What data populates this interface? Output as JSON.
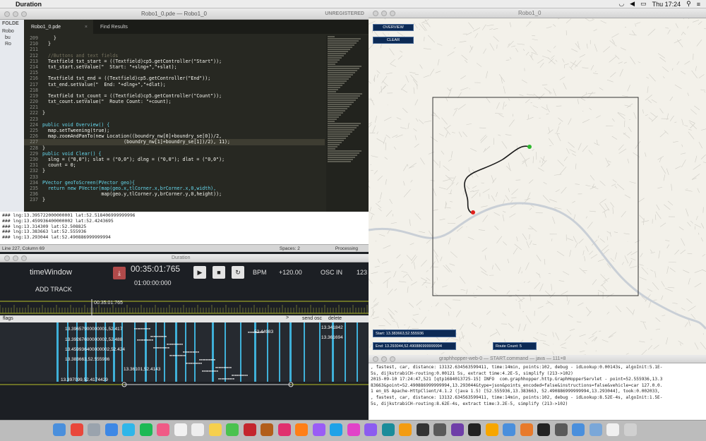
{
  "menubar": {
    "app_name": "Duration",
    "time": "Thu 17:24"
  },
  "sublime": {
    "title": "Robo1_0.pde — Robo1_0",
    "unregistered": "UNREGISTERED",
    "sidebar_header": "FOLDE",
    "sidebar_items": [
      "Robo",
      "bu",
      "Ro"
    ],
    "tabs": [
      "Robo1_0.pde",
      "Find Results"
    ],
    "code_lines": [
      {
        "n": "209",
        "t": "    }"
      },
      {
        "n": "210",
        "t": "  }"
      },
      {
        "n": "211",
        "t": ""
      },
      {
        "n": "212",
        "t": "  //Buttons and text fields"
      },
      {
        "n": "213",
        "t": "  Textfield txt_start = ((Textfield)cp5.getController(\"Start\"));"
      },
      {
        "n": "214",
        "t": "  txt_start.setValue(\"  Start: \"+slng+\",\"+slat);"
      },
      {
        "n": "215",
        "t": ""
      },
      {
        "n": "216",
        "t": "  Textfield txt_end = ((Textfield)cp5.getController(\"End\"));"
      },
      {
        "n": "217",
        "t": "  txt_end.setValue(\"  End: \"+dlng+\",\"+dlat);"
      },
      {
        "n": "218",
        "t": ""
      },
      {
        "n": "219",
        "t": "  Textfield txt_count = ((Textfield)cp5.getController(\"Count\"));"
      },
      {
        "n": "220",
        "t": "  txt_count.setValue(\"  Route Count: \"+count);"
      },
      {
        "n": "221",
        "t": ""
      },
      {
        "n": "222",
        "t": "}"
      },
      {
        "n": "223",
        "t": ""
      },
      {
        "n": "224",
        "t": "public void Overview() {"
      },
      {
        "n": "225",
        "t": "  map.setTweening(true);"
      },
      {
        "n": "226",
        "t": "  map.zoomAndPanTo(new Location((boundry_nw[0]+boundry_se[0])/2,"
      },
      {
        "n": "227",
        "t": "                             (boundry_nw[1]+boundry_se[1])/2), 11);"
      },
      {
        "n": "228",
        "t": "}"
      },
      {
        "n": "229",
        "t": "public void Clear() {"
      },
      {
        "n": "230",
        "t": "  slng = (\"0,0\"); slat = (\"0,0\"); dlng = (\"0,0\"); dlat = (\"0,0\");"
      },
      {
        "n": "231",
        "t": "  count = 0;"
      },
      {
        "n": "232",
        "t": "}"
      },
      {
        "n": "233",
        "t": ""
      },
      {
        "n": "234",
        "t": "PVector geoToScreen(PVector geo){"
      },
      {
        "n": "235",
        "t": "  return new PVector(map(geo.x,tlCorner.x,brCorner.x,0,width),"
      },
      {
        "n": "236",
        "t": "                     map(geo.y,tlCorner.y,brCorner.y,0,height));"
      },
      {
        "n": "237",
        "t": "}"
      }
    ],
    "console_lines": [
      "### lng:13.395722000000001 lat:52.518406999999996",
      "### lng:13.459936400000002 lat:52.4243695",
      "### lng:13.314309 lat:52.508825",
      "### lng:13.383663 lat:52.555936",
      "### lng:13.293044 lat:52.490886999999994"
    ],
    "status_left": "Line 227, Column 69",
    "status_spaces": "Spaces: 2",
    "status_lang": "Processing"
  },
  "map": {
    "title": "Robo1_0",
    "overview_label": "OVERVIEW",
    "clear_label": "CLEAR",
    "start_field": "Start: 13.383663,52.555936",
    "end_field": "End: 13.293044,52.490886999999994",
    "count_field": "Route Count: 5",
    "route_start_color": "#2db82d",
    "route_end_color": "#e0201c"
  },
  "terminal": {
    "title": "graphhopper-web-0 — START.command — java — 111×8",
    "lines": [
      ", fastest, car, distance: 13132.634563599411, time:14min, points:102, debug - idLookup:0.00143s, algoInit:5.1E-",
      "5s, dijkstrabiCH-routing:0.00121 5s, extract time:4.2E-5, simplify (213->102)",
      "2015-09-10 17:24:47,521 [qtp1684013725-15] INFO  com.graphhopper.http.GraphHopperServlet - point=52.555936,13.3",
      "83663&point=52.490886999999994,13.293044&type=json&points_encoded=false&instructions=false&vehicle=car 127.0.0.",
      "1 en_US Apache-HttpClient/4.1.2 (java 1.5) [52.555936,13.383663, 52.490886999999994,13.293044], took:0.002033,",
      ", fastest, car, distance: 13132.634563599411, time:14min, points:102, debug - idLookup:8.52E-4s, algoInit:1.5E-",
      "5s, dijkstrabiCH-routing:8.62E-4s, extract time:3.2E-5, simplify (213->102)"
    ]
  },
  "duration": {
    "title": "Duration",
    "track_name": "timeWindow",
    "add_track": "ADD TRACK",
    "time_main": "00:35:01:765",
    "time_sub": "01:00:00:000",
    "bpm_label": "BPM",
    "bpm_value": "+120.00",
    "osc_label": "OSC IN",
    "osc_value": "123",
    "playhead_time": "00:35:01:765",
    "flags_label": "flags",
    "send_osc": "send osc",
    "delete_label": "delete",
    "track_labels": [
      "13.39657900000001,52.417",
      "13.39267600000002,52.488",
      "13.459936400000002,52.424",
      "13.383663,52.555936",
      "13.36101,52.4143",
      "13.397099,52.4174429",
      "52.44983",
      "13.341842",
      "13.361694"
    ]
  },
  "dock": {
    "items": [
      "Finder",
      "Chrome",
      "Rocket",
      "Safari",
      "Chat",
      "Spotify",
      "iTunes",
      "Calendar",
      "TextEdit",
      "Notes",
      "Messages",
      "Flash",
      "Bridge",
      "InDesign",
      "Illustrator",
      "After Effects",
      "Audition",
      "Photoshop",
      "Premiere",
      "Arduino",
      "Sublime",
      "Terminal",
      "Preview",
      "Resolume",
      "Processing",
      "Sketch",
      "Finder2",
      "Books",
      "GitHub",
      "Ableton",
      "Mail",
      "Downloads",
      "Docs",
      "Trash"
    ]
  }
}
